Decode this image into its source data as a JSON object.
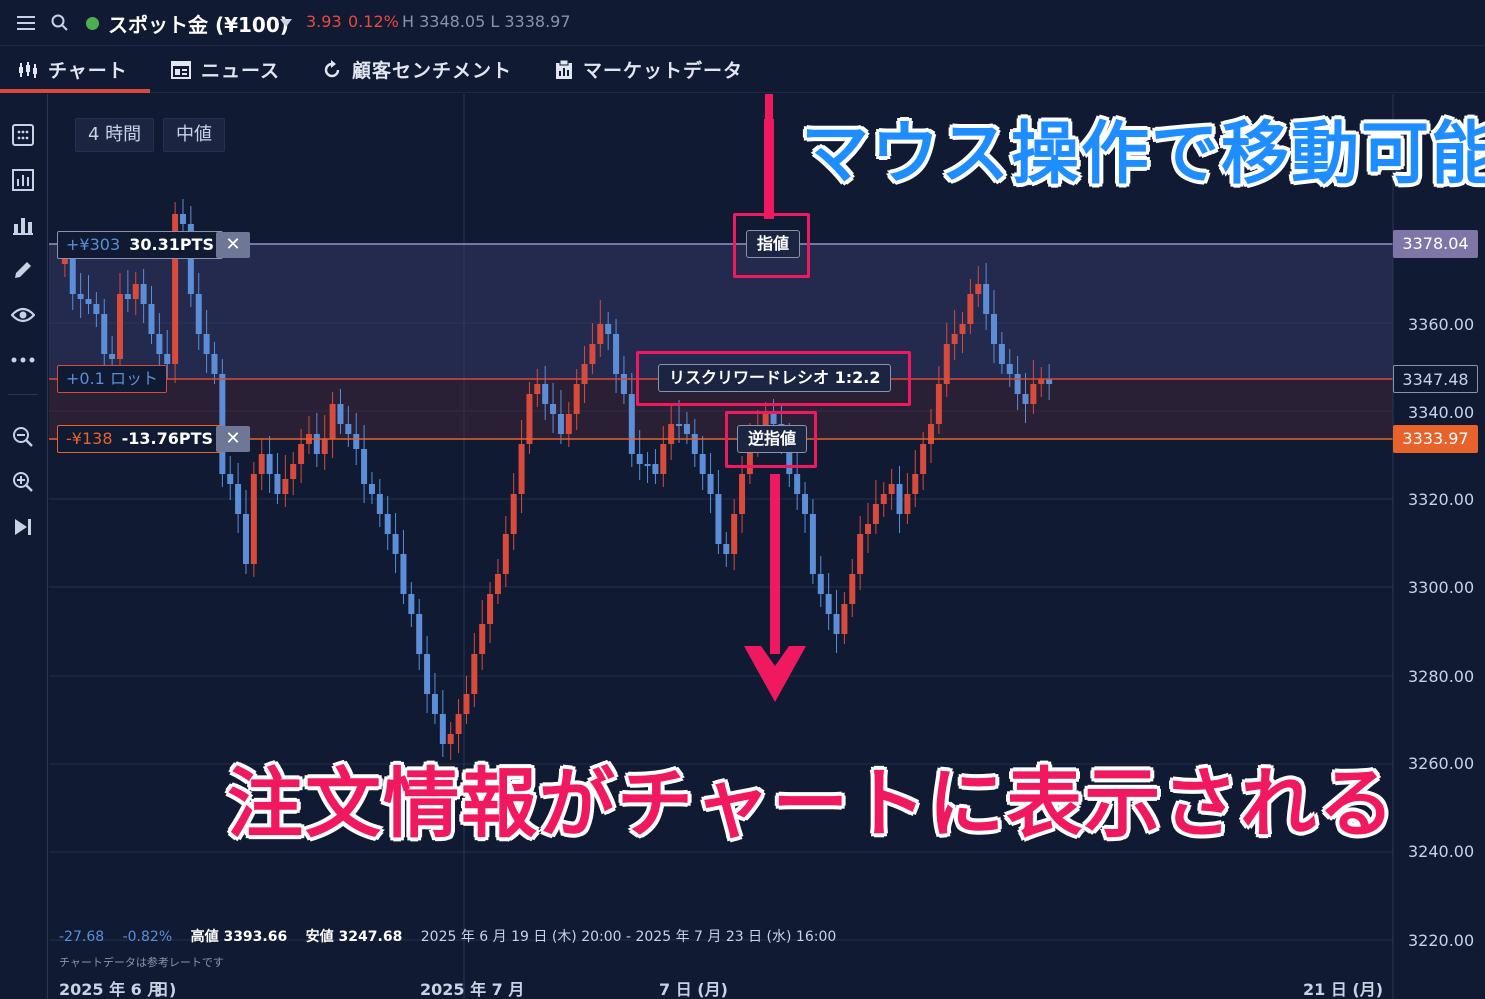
{
  "header": {
    "symbol": "スポット金 (¥100)",
    "change": "3.93",
    "change_pct": "0.12%",
    "high_low": "H 3348.05 L 3338.97",
    "status_color": "#4caf50"
  },
  "tabs": [
    {
      "label": "チャート",
      "icon": "chart-icon"
    },
    {
      "label": "ニュース",
      "icon": "news-icon"
    },
    {
      "label": "顧客センチメント",
      "icon": "refresh-icon"
    },
    {
      "label": "マーケットデータ",
      "icon": "clipboard-icon"
    }
  ],
  "sidebar_icons": [
    "calculator-icon",
    "indicator-icon",
    "bar-chart-icon",
    "pencil-icon",
    "eye-icon",
    "more-icon",
    "zoom-out-icon",
    "zoom-in-icon",
    "skip-forward-icon"
  ],
  "toolbar": {
    "timeframe": "4 時間",
    "price_type": "中値"
  },
  "price_axis": {
    "levels": [
      "3360.00",
      "3340.00",
      "3320.00",
      "3300.00",
      "3280.00",
      "3260.00",
      "3240.00",
      "3220.00"
    ],
    "limit_price": "3378.04",
    "current_price": "3347.48",
    "stop_price": "3333.97",
    "limit_color": "#7e76a6",
    "stop_color": "#e8632b"
  },
  "orders": {
    "take_profit_yen": "+¥303",
    "take_profit_pts": "30.31PTS",
    "lot": "+0.1 ロット",
    "stop_loss_yen": "-¥138",
    "stop_loss_pts": "-13.76PTS",
    "close_symbol": "✕"
  },
  "lines": {
    "limit_label": "指値",
    "ratio_label": "リスクリワードレシオ 1:2.2",
    "stop_label": "逆指値"
  },
  "annotations": {
    "move": "マウス操作で移動可能",
    "displayed": "注文情報がチャートに表示される"
  },
  "info": {
    "abs_change": "-27.68",
    "pct_change": "-0.82%",
    "high": "高値 3393.66",
    "low": "安値 3247.68",
    "range": "2025 年 6 月 19 日 (木) 20:00 - 2025 年 7 月 23 日 (水) 16:00",
    "note": "チャートデータは参考レートです"
  },
  "x_axis": [
    "2025 年 6 月",
    "日)",
    "2025 年 7 月",
    "7 日 (月)",
    "21 日 (月)"
  ],
  "colors": {
    "up": "#d84a3a",
    "down": "#5b8ed6",
    "accent": "#f0195f"
  }
}
